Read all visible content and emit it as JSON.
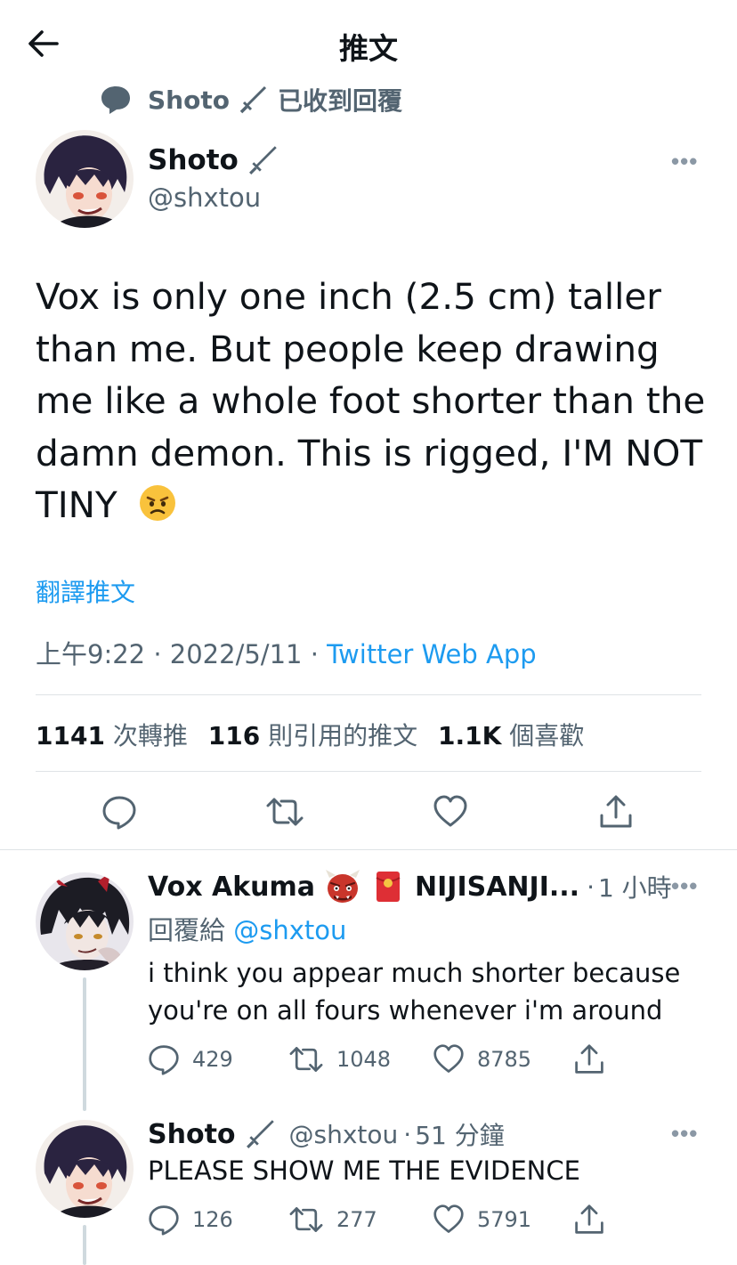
{
  "header": {
    "title": "推文"
  },
  "context": {
    "prefix": "Shoto",
    "suffix": "已收到回覆"
  },
  "main_tweet": {
    "author_name": "Shoto",
    "author_handle": "@shxtou",
    "text": "Vox is only one inch (2.5 cm) taller than me. But people keep drawing me like a whole foot shorter than the damn demon. This is rigged, I'M NOT TINY",
    "translate_label": "翻譯推文",
    "time": "上午9:22",
    "date": "2022/5/11",
    "source": "Twitter Web App",
    "retweets_count": "1141",
    "retweets_label": "次轉推",
    "quotes_count": "116",
    "quotes_label": "則引用的推文",
    "likes_count": "1.1K",
    "likes_label": "個喜歡"
  },
  "replies": [
    {
      "author_name": "Vox Akuma",
      "author_suffix": "NIJISANJI...",
      "time": "1 小時",
      "reply_to_label": "回覆給",
      "reply_to_handle": "@shxtou",
      "text_line1": "i think you appear much shorter because",
      "text_line2": "you're on all fours whenever i'm around",
      "replies": "429",
      "retweets": "1048",
      "likes": "8785"
    },
    {
      "author_name": "Shoto",
      "author_handle": "@shxtou",
      "time": "51 分鐘",
      "text": "PLEASE SHOW ME THE EVIDENCE",
      "replies": "126",
      "retweets": "277",
      "likes": "5791"
    }
  ],
  "colors": {
    "accent": "#1d9bf0",
    "secondary_text": "#536471",
    "primary_text": "#0f1419",
    "divider": "#dfe3e6"
  },
  "icons": [
    "back-arrow-icon",
    "speech-bubble-icon",
    "sword-icon",
    "more-icon",
    "reply-icon",
    "retweet-icon",
    "like-icon",
    "share-icon",
    "ogre-emoji-icon",
    "red-envelope-emoji-icon",
    "angry-face-emoji-icon"
  ]
}
